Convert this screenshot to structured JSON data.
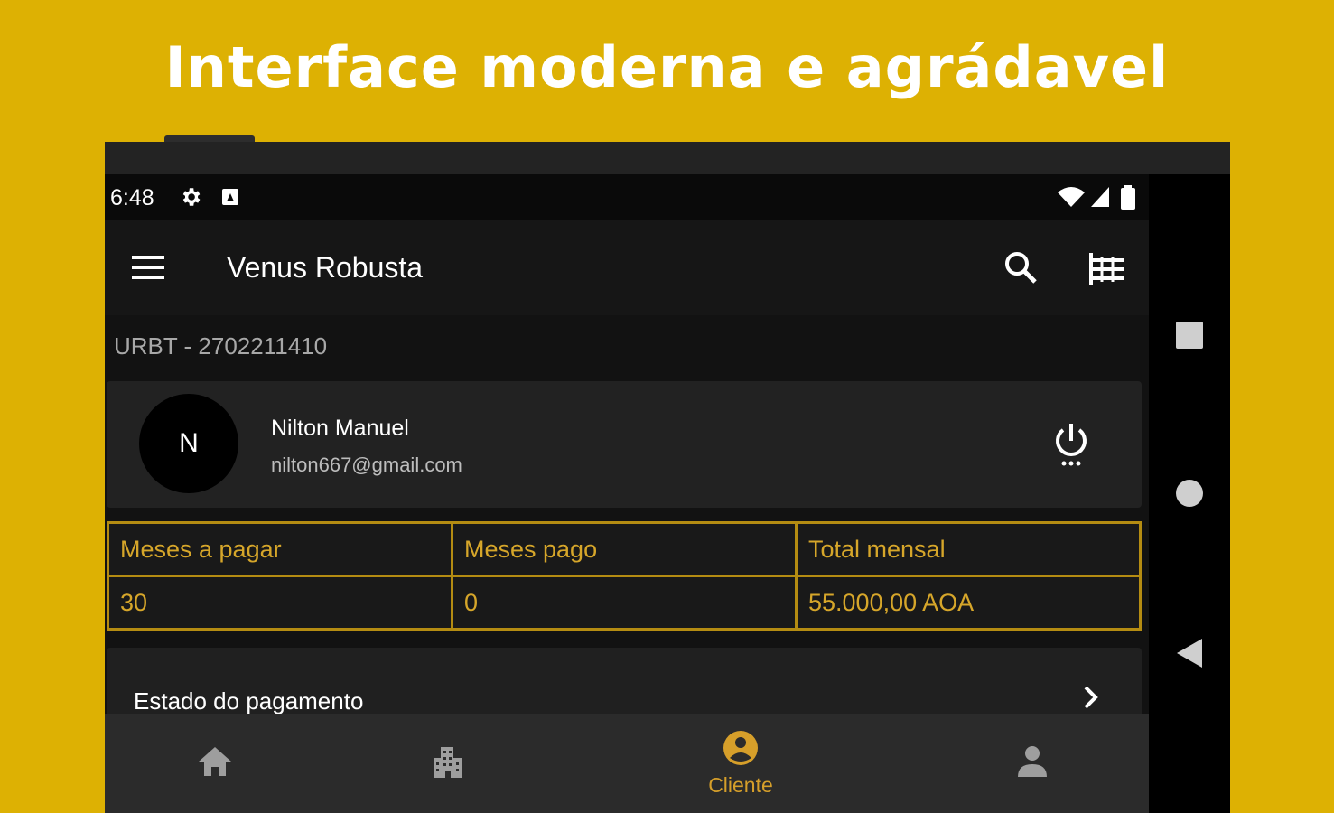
{
  "headline": "Interface moderna e agrádavel",
  "colors": {
    "background": "#ddb103",
    "accent": "#d69f2a",
    "screen": "#121212"
  },
  "status_bar": {
    "time": "6:48",
    "icons": [
      "gear-icon",
      "notification-icon",
      "wifi-icon",
      "signal-icon",
      "battery-icon"
    ]
  },
  "app_bar": {
    "menu_icon": "hamburger-menu-icon",
    "title": "Venus Robusta",
    "actions": [
      "search-icon",
      "filter-list-icon"
    ]
  },
  "account_code": "URBT - 2702211410",
  "user": {
    "initial": "N",
    "name": "Nilton Manuel",
    "email": "nilton667@gmail.com",
    "power_icon": "power-settings-icon"
  },
  "stats": {
    "headers": [
      "Meses a pagar",
      "Meses pago",
      "Total mensal"
    ],
    "values": [
      "30",
      "0",
      "55.000,00 AOA"
    ]
  },
  "payment_status": {
    "label": "Estado do pagamento"
  },
  "bottom_nav": {
    "items": [
      {
        "icon": "home-icon",
        "label": ""
      },
      {
        "icon": "building-icon",
        "label": ""
      },
      {
        "icon": "client-icon",
        "label": "Cliente",
        "active": true
      },
      {
        "icon": "person-icon",
        "label": ""
      }
    ]
  },
  "system_nav": [
    "recents-square-icon",
    "home-circle-icon",
    "back-triangle-icon"
  ]
}
